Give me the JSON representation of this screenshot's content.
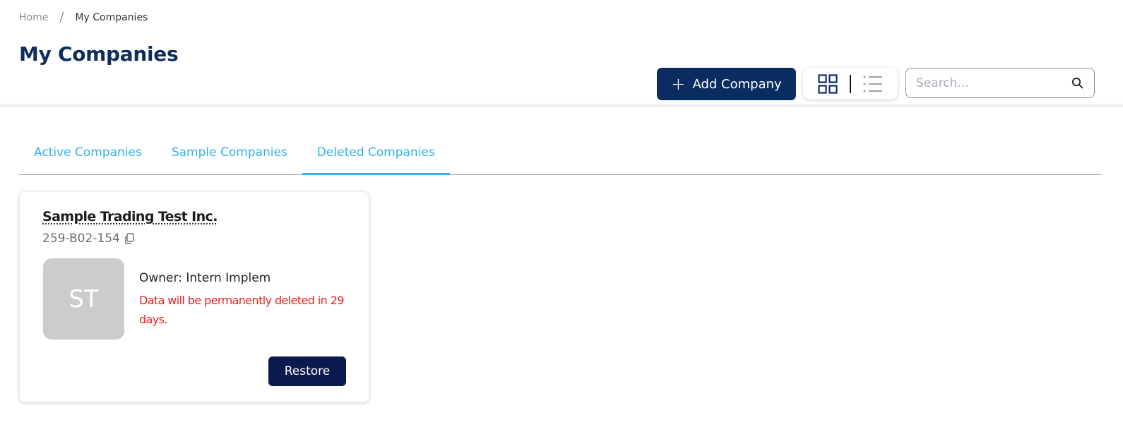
{
  "breadcrumb": {
    "home": "Home",
    "separator": "/",
    "current": "My Companies"
  },
  "page": {
    "title": "My Companies"
  },
  "toolbar": {
    "add_label": "Add Company",
    "add_icon": "plus-icon",
    "view_grid_icon": "grid-view-icon",
    "view_list_icon": "list-view-icon",
    "search_placeholder": "Search...",
    "search_icon": "search-icon"
  },
  "tabs": [
    {
      "label": "Active Companies",
      "active": false
    },
    {
      "label": "Sample Companies",
      "active": false
    },
    {
      "label": "Deleted Companies",
      "active": true
    }
  ],
  "companies": [
    {
      "name": "Sample Trading Test Inc.",
      "code": "259-B02-154",
      "initials": "ST",
      "owner": "Owner: Intern Implem",
      "warning": "Data will be permanently deleted in 29 days.",
      "restore_label": "Restore"
    }
  ],
  "colors": {
    "primary": "#0b2c61",
    "accent": "#2fb3ea",
    "danger": "#ef1f1f",
    "restore": "#0a1a4f",
    "avatar_bg": "#cccccc"
  }
}
